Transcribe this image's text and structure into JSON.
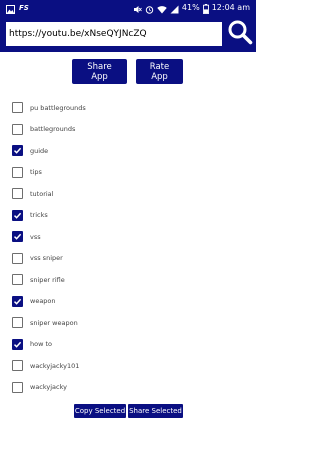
{
  "status_bar": {
    "left_label": "FS",
    "battery": "41%",
    "time": "12:04 am",
    "icons": [
      "image-icon",
      "fs-icon",
      "mute-icon",
      "alarm-icon",
      "wifi-icon",
      "signal-icon",
      "battery-icon"
    ]
  },
  "url_bar": {
    "value": "https://youtu.be/xNseQYJNcZQ",
    "search_icon": "search-icon"
  },
  "actions": {
    "share_app": "Share App",
    "rate_app": "Rate App"
  },
  "tags": [
    {
      "label": "pu battlegrounds",
      "checked": false
    },
    {
      "label": "battlegrounds",
      "checked": false
    },
    {
      "label": "guide",
      "checked": true
    },
    {
      "label": "tips",
      "checked": false
    },
    {
      "label": "tutorial",
      "checked": false
    },
    {
      "label": "tricks",
      "checked": true
    },
    {
      "label": "vss",
      "checked": true
    },
    {
      "label": "vss sniper",
      "checked": false
    },
    {
      "label": "sniper rifle",
      "checked": false
    },
    {
      "label": "weapon",
      "checked": true
    },
    {
      "label": "sniper weapon",
      "checked": false
    },
    {
      "label": "how to",
      "checked": true
    },
    {
      "label": "wackyjacky101",
      "checked": false
    },
    {
      "label": "wackyjacky",
      "checked": false
    }
  ],
  "bottom": {
    "copy_selected": "Copy Selected",
    "share_selected": "Share Selected"
  },
  "colors": {
    "primary": "#0a0f82",
    "checkbox_border": "#6e6e6e",
    "label_text": "#444444"
  }
}
